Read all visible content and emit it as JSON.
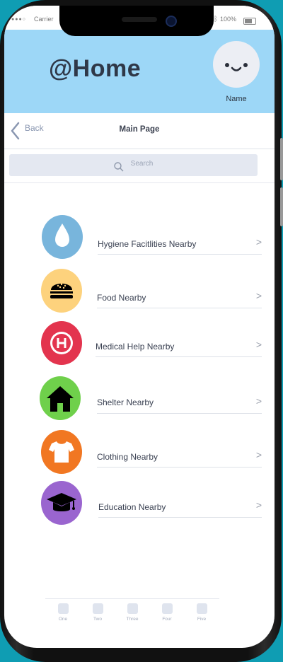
{
  "status_bar": {
    "carrier": "Carrier",
    "battery": "100%"
  },
  "header": {
    "app_title": "@Home",
    "profile_name": "Name"
  },
  "navbar": {
    "back_label": "Back",
    "title": "Main Page"
  },
  "search": {
    "placeholder": "Search"
  },
  "categories": [
    {
      "label": "Hygiene Facitlities Nearby",
      "icon": "water-drop-icon",
      "color": "#78b5dc"
    },
    {
      "label": "Food Nearby",
      "icon": "burger-icon",
      "color": "#fdd27d"
    },
    {
      "label": "Medical Help Nearby",
      "icon": "hospital-icon",
      "color": "#e3344e"
    },
    {
      "label": "Shelter Nearby",
      "icon": "house-icon",
      "color": "#6fd04b"
    },
    {
      "label": "Clothing Nearby",
      "icon": "tshirt-icon",
      "color": "#f17722"
    },
    {
      "label": "Education Nearby",
      "icon": "graduation-cap-icon",
      "color": "#9a65cf"
    }
  ],
  "chevron": ">",
  "tabs": [
    {
      "label": "One"
    },
    {
      "label": "Two"
    },
    {
      "label": "Three"
    },
    {
      "label": "Four"
    },
    {
      "label": "Five"
    }
  ]
}
